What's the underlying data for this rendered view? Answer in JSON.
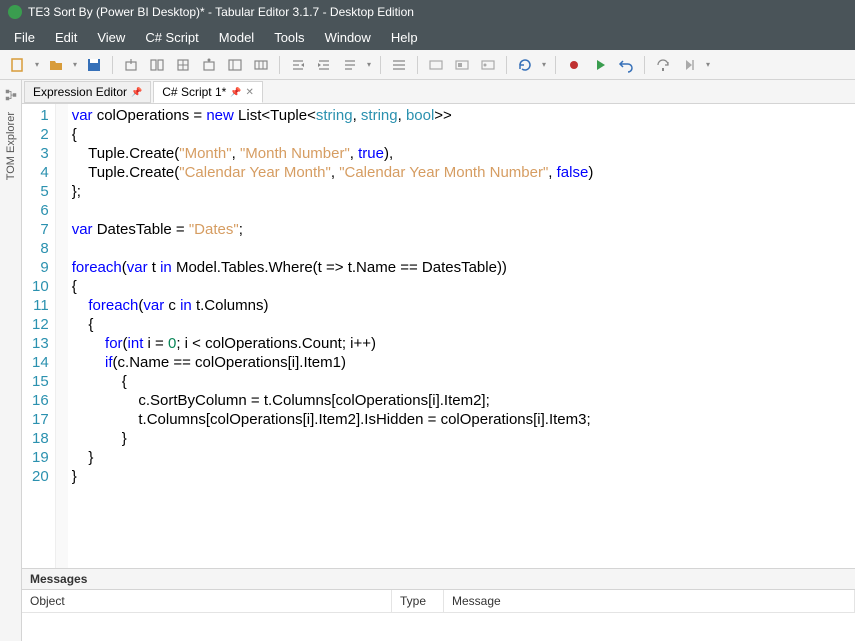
{
  "titlebar": {
    "text": "TE3 Sort By (Power BI Desktop)* - Tabular Editor 3.1.7 - Desktop Edition"
  },
  "menubar": {
    "items": [
      "File",
      "Edit",
      "View",
      "C# Script",
      "Model",
      "Tools",
      "Window",
      "Help"
    ]
  },
  "sidebar": {
    "label": "TOM Explorer"
  },
  "tabs": {
    "items": [
      {
        "label": "Expression Editor",
        "pinned": true,
        "active": false
      },
      {
        "label": "C# Script 1*",
        "pinned": true,
        "closable": true,
        "active": true
      }
    ]
  },
  "code": {
    "lines": [
      {
        "n": 1,
        "tokens": [
          [
            "kw",
            "var"
          ],
          [
            "",
            " colOperations = "
          ],
          [
            "kw",
            "new"
          ],
          [
            "",
            " List<Tuple<"
          ],
          [
            "typ",
            "string"
          ],
          [
            "",
            ", "
          ],
          [
            "typ",
            "string"
          ],
          [
            "",
            ", "
          ],
          [
            "typ",
            "bool"
          ],
          [
            "",
            ">>"
          ]
        ]
      },
      {
        "n": 2,
        "tokens": [
          [
            "",
            "{"
          ]
        ]
      },
      {
        "n": 3,
        "tokens": [
          [
            "",
            "    Tuple.Create("
          ],
          [
            "str",
            "\"Month\""
          ],
          [
            "",
            ", "
          ],
          [
            "str",
            "\"Month Number\""
          ],
          [
            "",
            ", "
          ],
          [
            "bool",
            "true"
          ],
          [
            "",
            "),"
          ]
        ]
      },
      {
        "n": 4,
        "tokens": [
          [
            "",
            "    Tuple.Create("
          ],
          [
            "str",
            "\"Calendar Year Month\""
          ],
          [
            "",
            ", "
          ],
          [
            "str",
            "\"Calendar Year Month Number\""
          ],
          [
            "",
            ", "
          ],
          [
            "bool",
            "false"
          ],
          [
            "",
            ")"
          ]
        ]
      },
      {
        "n": 5,
        "tokens": [
          [
            "",
            "};"
          ]
        ]
      },
      {
        "n": 6,
        "tokens": [
          [
            "",
            ""
          ]
        ]
      },
      {
        "n": 7,
        "tokens": [
          [
            "kw",
            "var"
          ],
          [
            "",
            " DatesTable = "
          ],
          [
            "str",
            "\"Dates\""
          ],
          [
            "",
            ";"
          ]
        ]
      },
      {
        "n": 8,
        "tokens": [
          [
            "",
            ""
          ]
        ]
      },
      {
        "n": 9,
        "tokens": [
          [
            "kw",
            "foreach"
          ],
          [
            "",
            "("
          ],
          [
            "kw",
            "var"
          ],
          [
            "",
            " t "
          ],
          [
            "kw",
            "in"
          ],
          [
            "",
            " Model.Tables.Where(t => t.Name == DatesTable))"
          ]
        ]
      },
      {
        "n": 10,
        "tokens": [
          [
            "",
            "{"
          ]
        ]
      },
      {
        "n": 11,
        "tokens": [
          [
            "",
            "    "
          ],
          [
            "kw",
            "foreach"
          ],
          [
            "",
            "("
          ],
          [
            "kw",
            "var"
          ],
          [
            "",
            " c "
          ],
          [
            "kw",
            "in"
          ],
          [
            "",
            " t.Columns)"
          ]
        ]
      },
      {
        "n": 12,
        "tokens": [
          [
            "",
            "    {"
          ]
        ]
      },
      {
        "n": 13,
        "tokens": [
          [
            "",
            "        "
          ],
          [
            "kw",
            "for"
          ],
          [
            "",
            "("
          ],
          [
            "kw",
            "int"
          ],
          [
            "",
            " i = "
          ],
          [
            "num",
            "0"
          ],
          [
            "",
            "; i < colOperations.Count; i++)"
          ]
        ]
      },
      {
        "n": 14,
        "tokens": [
          [
            "",
            "        "
          ],
          [
            "kw",
            "if"
          ],
          [
            "",
            "(c.Name == colOperations[i].Item1)"
          ]
        ]
      },
      {
        "n": 15,
        "tokens": [
          [
            "",
            "            {"
          ]
        ]
      },
      {
        "n": 16,
        "tokens": [
          [
            "",
            "                c.SortByColumn = t.Columns[colOperations[i].Item2];"
          ]
        ]
      },
      {
        "n": 17,
        "tokens": [
          [
            "",
            "                t.Columns[colOperations[i].Item2].IsHidden = colOperations[i].Item3;"
          ]
        ]
      },
      {
        "n": 18,
        "tokens": [
          [
            "",
            "            }"
          ]
        ]
      },
      {
        "n": 19,
        "tokens": [
          [
            "",
            "    }"
          ]
        ]
      },
      {
        "n": 20,
        "tokens": [
          [
            "",
            "}"
          ]
        ]
      }
    ]
  },
  "messages": {
    "title": "Messages",
    "cols": {
      "object": "Object",
      "type": "Type",
      "message": "Message"
    }
  }
}
